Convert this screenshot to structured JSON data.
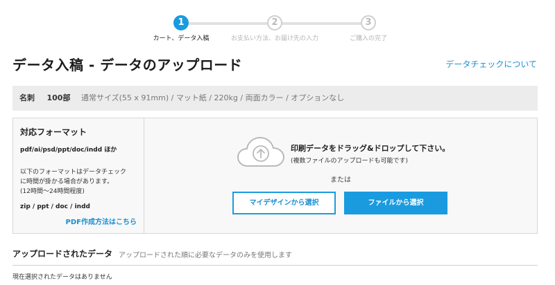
{
  "stepper": {
    "steps": [
      {
        "number": "1",
        "label": "カート、データ入稿",
        "state": "active"
      },
      {
        "number": "2",
        "label": "お支払い方法、お届け先の入力",
        "state": "inactive"
      },
      {
        "number": "3",
        "label": "ご購入の完了",
        "state": "inactive"
      }
    ]
  },
  "header": {
    "title": "データ入稿 - データのアップロード",
    "about_link": "データチェックについて"
  },
  "summary": {
    "product": "名刺",
    "quantity": "100部",
    "spec": "通常サイズ(55 x 91mm) / マット紙 / 220kg / 両面カラー / オプションなし"
  },
  "formats": {
    "title": "対応フォーマット",
    "main_formats": "pdf/ai/psd/ppt/doc/indd ほか",
    "note_lines": [
      "以下のフォーマットはデータチェック",
      "に時間が掛かる場合があります。",
      "(12時間〜24時間程度)"
    ],
    "slow_formats": "zip / ppt / doc / indd",
    "pdf_link": "PDF作成方法はこちら"
  },
  "dropzone": {
    "icon": "cloud-upload-icon",
    "title": "印刷データをドラッグ&ドロップして下さい。",
    "subtitle": "(複数ファイルのアップロードも可能です)",
    "or_text": "または",
    "mydesign_button": "マイデザインから選択",
    "file_button": "ファイルから選択"
  },
  "uploaded": {
    "title": "アップロードされたデータ",
    "note": "アップロードされた順に必要なデータのみを使用します",
    "empty_text": "現在選択されたデータはありません"
  },
  "colors": {
    "accent": "#1a9be0",
    "link": "#1a8fd0",
    "summary_bg": "#ececec"
  }
}
